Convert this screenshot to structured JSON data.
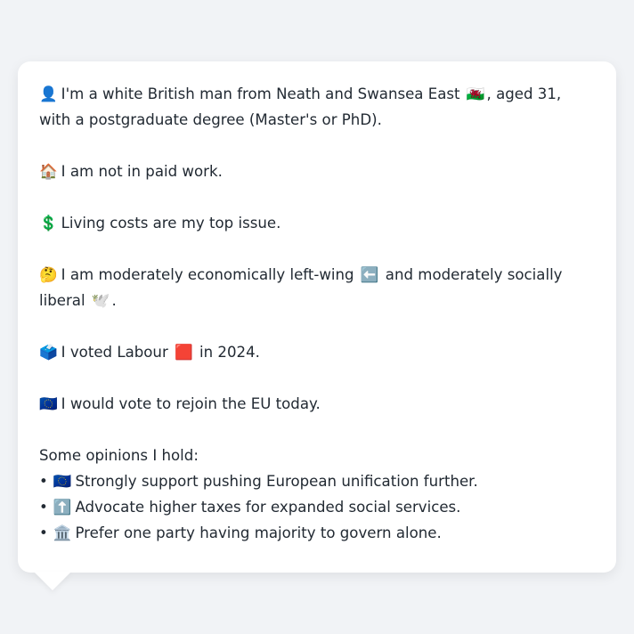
{
  "profile": {
    "identity": {
      "icon": "👤",
      "text_before_flag": "I'm a white British man from Neath and Swansea East",
      "flag": "🏴󠁧󠁢󠁷󠁬󠁳󠁿",
      "text_after_flag": ", aged 31, with a postgraduate degree (Master's or PhD)."
    },
    "work": {
      "icon": "🏠",
      "text": "I am not in paid work."
    },
    "issue": {
      "icon": "💲",
      "text": "Living costs are my top issue."
    },
    "ideology": {
      "icon": "🤔",
      "text_before_arrow": "I am moderately economically left-wing",
      "arrow": "⬅️",
      "text_mid": "and moderately socially liberal",
      "dove": "🕊️",
      "text_end": "."
    },
    "vote": {
      "icon": "🗳️",
      "text_before_square": "I voted Labour",
      "square": "🟥",
      "text_after_square": "in 2024."
    },
    "eu": {
      "icon": "🇪🇺",
      "text": "I would vote to rejoin the EU today."
    },
    "opinions_heading": "Some opinions I hold:",
    "opinions": [
      {
        "bullet": "•",
        "icon": "🇪🇺",
        "text": "Strongly support pushing European unification further."
      },
      {
        "bullet": "•",
        "icon": "⬆️",
        "text": "Advocate higher taxes for expanded social services."
      },
      {
        "bullet": "•",
        "icon": "🏛️",
        "text": "Prefer one party having majority to govern alone."
      }
    ]
  }
}
